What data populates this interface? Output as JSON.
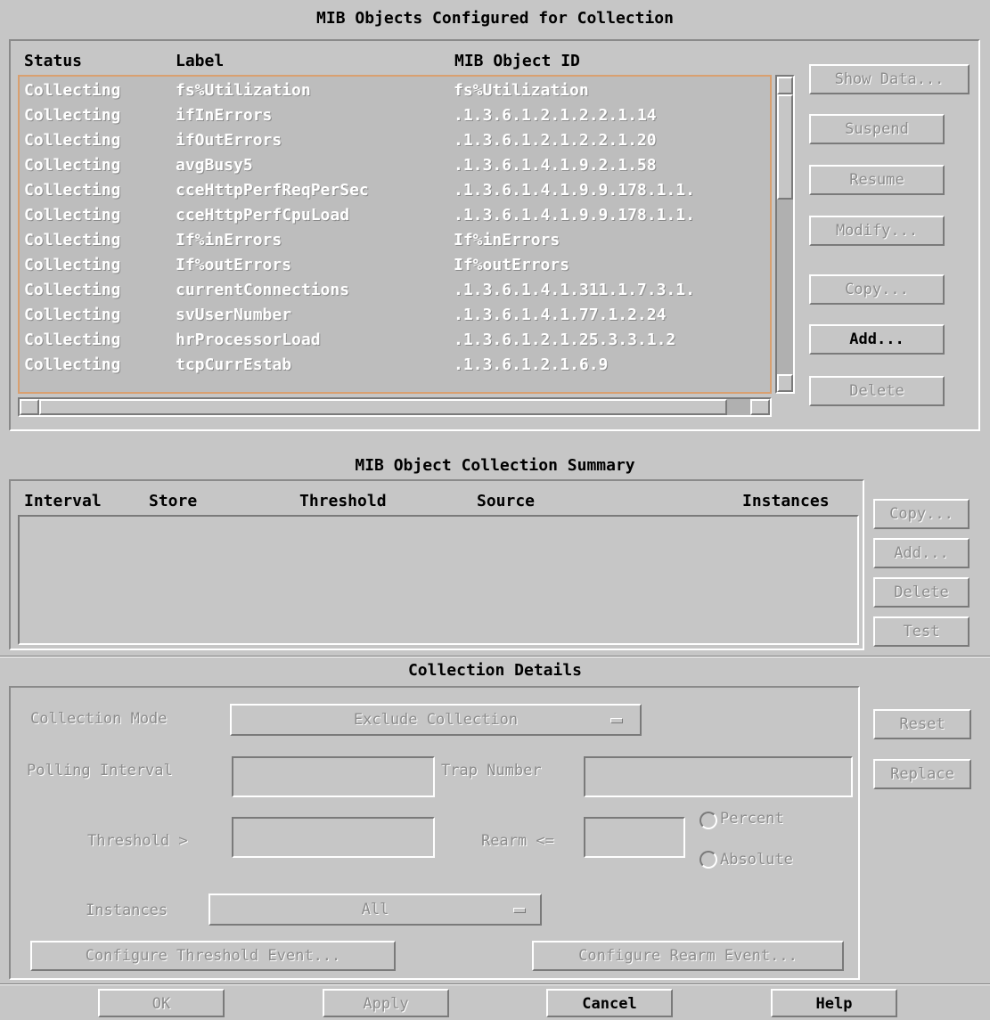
{
  "config_section": {
    "title": "MIB Objects Configured for Collection",
    "columns": [
      "Status",
      "Label",
      "MIB Object ID"
    ],
    "rows": [
      {
        "status": "Collecting",
        "label": "fs%Utilization",
        "oid": "fs%Utilization"
      },
      {
        "status": "Collecting",
        "label": "ifInErrors",
        "oid": ".1.3.6.1.2.1.2.2.1.14"
      },
      {
        "status": "Collecting",
        "label": "ifOutErrors",
        "oid": ".1.3.6.1.2.1.2.2.1.20"
      },
      {
        "status": "Collecting",
        "label": "avgBusy5",
        "oid": ".1.3.6.1.4.1.9.2.1.58"
      },
      {
        "status": "Collecting",
        "label": "cceHttpPerfReqPerSec",
        "oid": ".1.3.6.1.4.1.9.9.178.1.1."
      },
      {
        "status": "Collecting",
        "label": "cceHttpPerfCpuLoad",
        "oid": ".1.3.6.1.4.1.9.9.178.1.1."
      },
      {
        "status": "Collecting",
        "label": "If%inErrors",
        "oid": "If%inErrors"
      },
      {
        "status": "Collecting",
        "label": "If%outErrors",
        "oid": "If%outErrors"
      },
      {
        "status": "Collecting",
        "label": "currentConnections",
        "oid": ".1.3.6.1.4.1.311.1.7.3.1."
      },
      {
        "status": "Collecting",
        "label": "svUserNumber",
        "oid": ".1.3.6.1.4.1.77.1.2.24"
      },
      {
        "status": "Collecting",
        "label": "hrProcessorLoad",
        "oid": ".1.3.6.1.2.1.25.3.3.1.2"
      },
      {
        "status": "Collecting",
        "label": "tcpCurrEstab",
        "oid": ".1.3.6.1.2.1.6.9"
      }
    ],
    "buttons": {
      "show_data": "Show Data...",
      "suspend": "Suspend",
      "resume": "Resume",
      "modify": "Modify...",
      "copy": "Copy...",
      "add": "Add...",
      "delete": "Delete"
    }
  },
  "summary_section": {
    "title": "MIB Object Collection Summary",
    "columns": {
      "interval": "Interval",
      "store": "Store",
      "threshold": "Threshold",
      "source": "Source",
      "instances": "Instances"
    },
    "buttons": {
      "copy": "Copy...",
      "add": "Add...",
      "delete": "Delete",
      "test": "Test"
    }
  },
  "details_section": {
    "title": "Collection Details",
    "collection_mode_label": "Collection Mode",
    "collection_mode_value": "Exclude Collection",
    "polling_interval_label": "Polling Interval",
    "trap_number_label": "Trap Number",
    "threshold_label": "Threshold >",
    "rearm_label": "Rearm <=",
    "percent_label": "Percent",
    "absolute_label": "Absolute",
    "instances_label": "Instances",
    "instances_value": "All",
    "configure_threshold_event": "Configure Threshold Event...",
    "configure_rearm_event": "Configure Rearm Event...",
    "reset": "Reset",
    "replace": "Replace"
  },
  "footer": {
    "ok": "OK",
    "apply": "Apply",
    "cancel": "Cancel",
    "help": "Help"
  }
}
